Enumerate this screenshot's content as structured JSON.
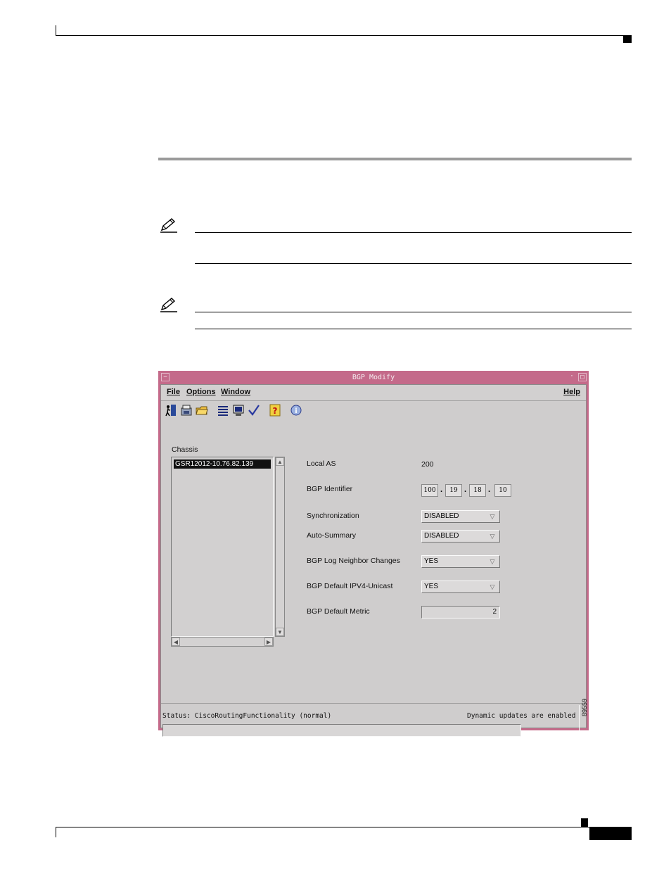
{
  "window": {
    "title": "BGP Modify",
    "menus": [
      "File",
      "Options",
      "Window"
    ],
    "help_menu": "Help",
    "toolbar_icons": [
      "exit-icon",
      "save-icon",
      "open-folder-icon",
      "list-icon",
      "monitor-icon",
      "checkmark-icon",
      "help-icon",
      "info-icon"
    ]
  },
  "chassis": {
    "label": "Chassis",
    "items": [
      "GSR12012-10.76.82.139"
    ]
  },
  "form": {
    "local_as_label": "Local AS",
    "local_as_value": "200",
    "bgp_identifier_label": "BGP Identifier",
    "bgp_identifier": [
      "100",
      "19",
      "18",
      "10"
    ],
    "synchronization_label": "Synchronization",
    "synchronization_value": "DISABLED",
    "auto_summary_label": "Auto-Summary",
    "auto_summary_value": "DISABLED",
    "log_neighbor_label": "BGP Log Neighbor Changes",
    "log_neighbor_value": "YES",
    "default_ipv4_label": "BGP Default IPV4-Unicast",
    "default_ipv4_value": "YES",
    "default_metric_label": "BGP Default Metric",
    "default_metric_value": "2"
  },
  "status": {
    "text": "Status: CiscoRoutingFunctionality (normal)",
    "dynamic": "Dynamic updates are enabled"
  },
  "figure_number": "89559",
  "colors": {
    "window_frame": "#c46a8a",
    "window_bg": "#cfcdcd"
  }
}
